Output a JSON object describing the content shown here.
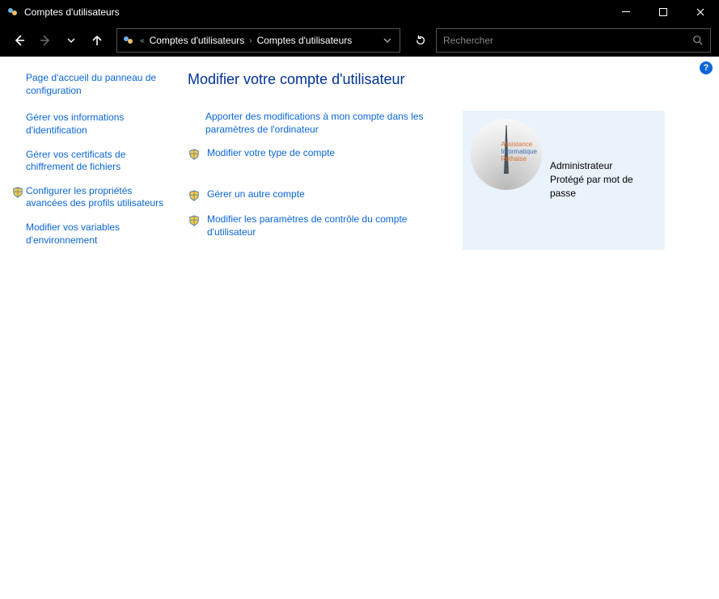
{
  "window": {
    "title": "Comptes d'utilisateurs"
  },
  "breadcrumb": {
    "prefix": "«",
    "parts": [
      "Comptes d'utilisateurs",
      "Comptes d'utilisateurs"
    ]
  },
  "search": {
    "placeholder": "Rechercher"
  },
  "sidebar": {
    "header": "Page d'accueil du panneau de configuration",
    "items": [
      {
        "label": "Gérer vos informations d'identification",
        "shield": false
      },
      {
        "label": "Gérer vos certificats de chiffrement de fichiers",
        "shield": false
      },
      {
        "label": "Configurer les propriétés avancées des profils utilisateurs",
        "shield": true
      },
      {
        "label": "Modifier vos variables d'environnement",
        "shield": false
      }
    ]
  },
  "main": {
    "heading": "Modifier votre compte d'utilisateur",
    "tasks": [
      {
        "label": "Apporter des modifications à mon compte dans les paramètres de l'ordinateur",
        "shield": false
      },
      {
        "label": "Modifier votre type de compte",
        "shield": true
      }
    ],
    "tasks2": [
      {
        "label": "Gérer un autre compte",
        "shield": true
      },
      {
        "label": "Modifier les paramètres de contrôle du compte d'utilisateur",
        "shield": true
      }
    ]
  },
  "account": {
    "logo": {
      "l1": "Assistance",
      "l2": "Informatique",
      "l3": "Réthaise"
    },
    "role": "Administrateur",
    "protection": "Protégé par mot de passe"
  },
  "help": {
    "symbol": "?"
  }
}
